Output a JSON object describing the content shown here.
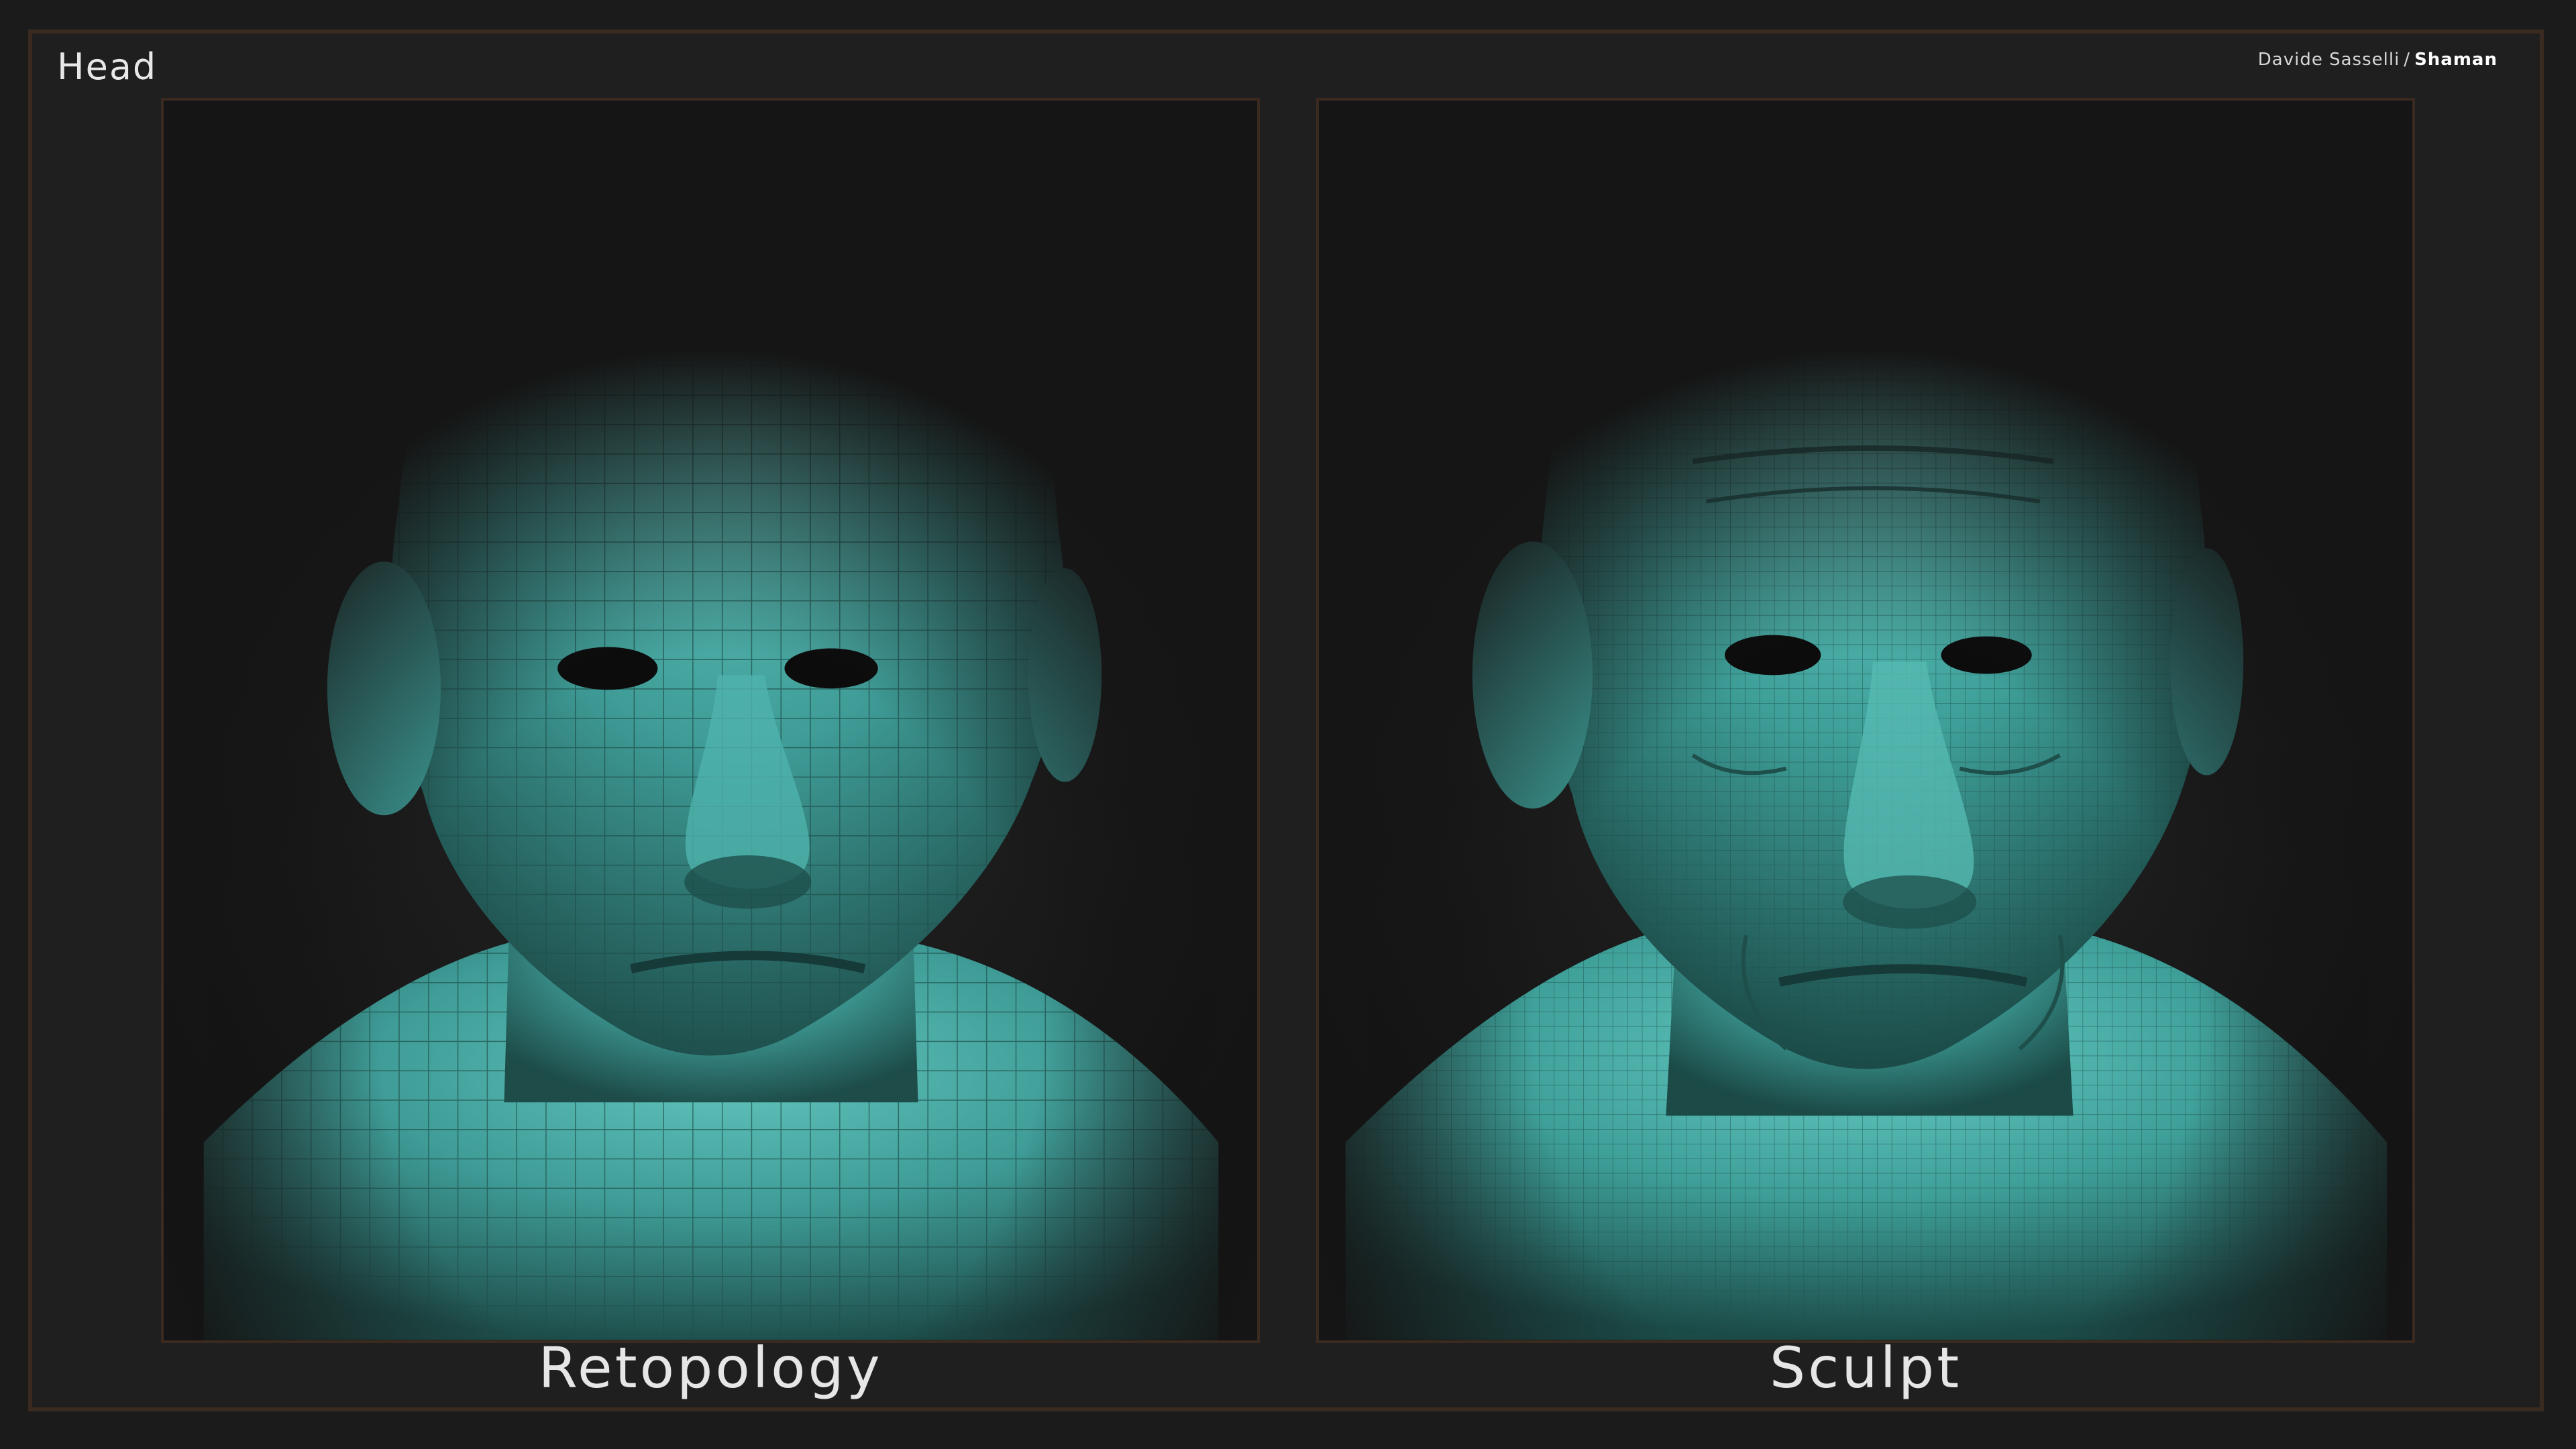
{
  "page": {
    "title": "Head",
    "credit": {
      "artist": "Davide Sasselli",
      "separator": "/",
      "project": "Shaman"
    }
  },
  "panels": [
    {
      "caption": "Retopology",
      "image": "low-poly-wireframe-head-render"
    },
    {
      "caption": "Sculpt",
      "image": "high-detail-sculpted-head-render"
    }
  ],
  "colors": {
    "background": "#1b1b1b",
    "frame_border": "#3a2a20",
    "model_teal": "#3f9c97",
    "model_highlight": "#5fc3bb",
    "wire": "#1e4f4b"
  }
}
